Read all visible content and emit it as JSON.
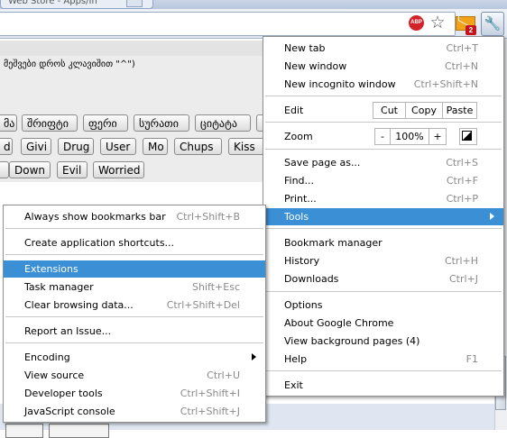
{
  "tab": {
    "title": "Web Store - Apps/Ih"
  },
  "toolbar": {
    "abp_label": "ABP",
    "mail_badge": "2"
  },
  "page": {
    "hint": "მეშვები დროს კლავიშით \"^\")",
    "row1": [
      "მა",
      "შრიფტი",
      "ფერი",
      "სურათი",
      "ციტატა"
    ],
    "row2": [
      "d",
      "Givi",
      "Drug",
      "User",
      "Mo",
      "Chups",
      "Kiss"
    ],
    "row3": [
      "Down",
      "Evil",
      "Worried"
    ]
  },
  "main_menu": {
    "new_tab": {
      "label": "New tab",
      "shortcut": "Ctrl+T"
    },
    "new_window": {
      "label": "New window",
      "shortcut": "Ctrl+N"
    },
    "new_incognito": {
      "label": "New incognito window",
      "shortcut": "Ctrl+Shift+N"
    },
    "edit": {
      "label": "Edit",
      "cut": "Cut",
      "copy": "Copy",
      "paste": "Paste"
    },
    "zoom": {
      "label": "Zoom",
      "minus": "-",
      "value": "100%",
      "plus": "+"
    },
    "save_page": {
      "label": "Save page as...",
      "shortcut": "Ctrl+S"
    },
    "find": {
      "label": "Find...",
      "shortcut": "Ctrl+F"
    },
    "print": {
      "label": "Print...",
      "shortcut": "Ctrl+P"
    },
    "tools": {
      "label": "Tools"
    },
    "bookmark_manager": {
      "label": "Bookmark manager"
    },
    "history": {
      "label": "History",
      "shortcut": "Ctrl+H"
    },
    "downloads": {
      "label": "Downloads",
      "shortcut": "Ctrl+J"
    },
    "options": {
      "label": "Options"
    },
    "about": {
      "label": "About Google Chrome"
    },
    "background_pages": {
      "label": "View background pages (4)"
    },
    "help": {
      "label": "Help",
      "shortcut": "F1"
    },
    "exit": {
      "label": "Exit"
    }
  },
  "tools_menu": {
    "bookmarks_bar": {
      "label": "Always show bookmarks bar",
      "shortcut": "Ctrl+Shift+B"
    },
    "app_shortcuts": {
      "label": "Create application shortcuts..."
    },
    "extensions": {
      "label": "Extensions"
    },
    "task_manager": {
      "label": "Task manager",
      "shortcut": "Shift+Esc"
    },
    "clear_data": {
      "label": "Clear browsing data...",
      "shortcut": "Ctrl+Shift+Del"
    },
    "report_issue": {
      "label": "Report an Issue..."
    },
    "encoding": {
      "label": "Encoding"
    },
    "view_source": {
      "label": "View source",
      "shortcut": "Ctrl+U"
    },
    "dev_tools": {
      "label": "Developer tools",
      "shortcut": "Ctrl+Shift+I"
    },
    "js_console": {
      "label": "JavaScript console",
      "shortcut": "Ctrl+Shift+J"
    }
  },
  "colors": {
    "highlight": "#3b8fd4",
    "menu_border": "#8f8f8f",
    "shortcut_text": "#8a8a8a"
  }
}
